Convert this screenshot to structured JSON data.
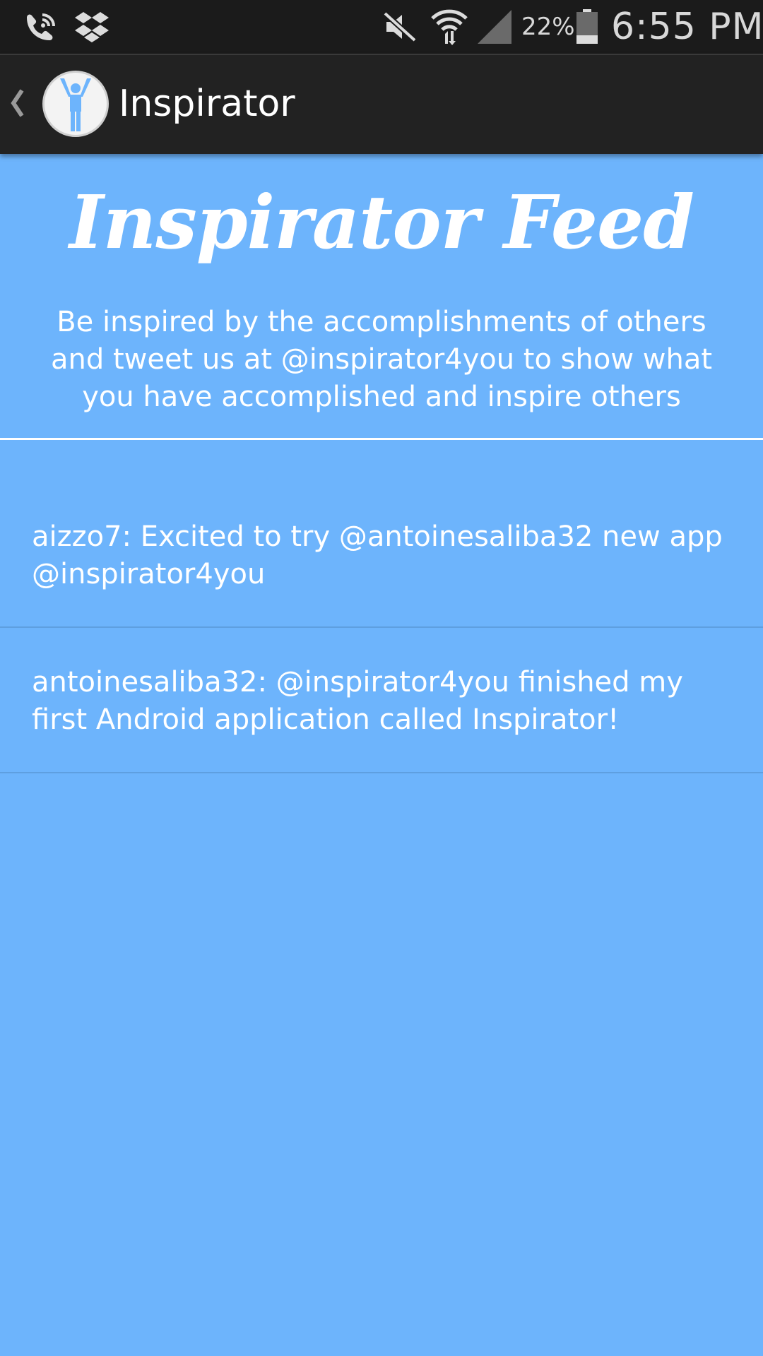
{
  "status_bar": {
    "icons": [
      "wifi-calling-icon",
      "dropbox-icon",
      "mute-icon",
      "wifi-icon",
      "signal-icon",
      "battery-icon"
    ],
    "battery_percent": "22%",
    "time": "6:55 PM"
  },
  "action_bar": {
    "title": "Inspirator",
    "logo_icon": "inspirator-logo-icon",
    "up_icon": "back-caret-icon"
  },
  "header": {
    "title": "Inspirator Feed",
    "subtitle": "Be inspired by the accomplishments of others and tweet us at @inspirator4you to show what you have accomplished and inspire others"
  },
  "feed": {
    "items": [
      {
        "text": "aizzo7: Excited to try @antoinesaliba32 new app @inspirator4you"
      },
      {
        "text": "antoinesaliba32: @inspirator4you finished my first Android application called Inspirator!"
      }
    ]
  },
  "colors": {
    "background": "#6db4fc",
    "action_bar": "#222222",
    "status_bar": "#1b1b1b",
    "text": "#ffffff"
  }
}
